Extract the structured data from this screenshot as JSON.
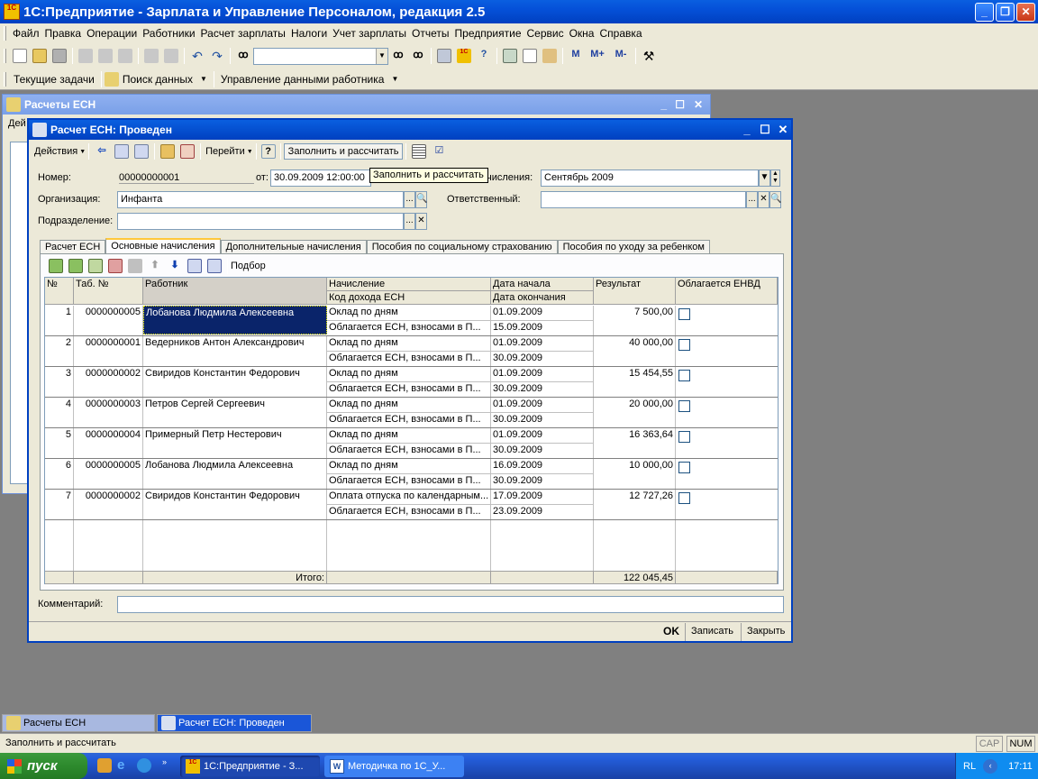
{
  "app": {
    "title": "1С:Предприятие - Зарплата и Управление Персоналом, редакция 2.5",
    "logo": "1C"
  },
  "menu": [
    "Файл",
    "Правка",
    "Операции",
    "Работники",
    "Расчет зарплаты",
    "Налоги",
    "Учет зарплаты",
    "Отчеты",
    "Предприятие",
    "Сервис",
    "Окна",
    "Справка"
  ],
  "toolbar2": {
    "current_tasks": "Текущие задачи",
    "search_data": "Поиск данных",
    "employee_data": "Управление данными работника"
  },
  "backwin": {
    "title": "Расчеты ЕСН",
    "actions": "Дей"
  },
  "doc": {
    "title": "Расчет ЕСН: Проведен",
    "actions_label": "Действия",
    "goto_label": "Перейти",
    "help_label": "?",
    "fill_button": "Заполнить и рассчитать",
    "tooltip": "Заполнить и рассчитать",
    "number_label": "Номер:",
    "number_value": "00000000001",
    "date_label": "от:",
    "date_value": "30.09.2009 12:00:00",
    "month_label": "числения:",
    "month_value": "Сентябрь 2009",
    "org_label": "Организация:",
    "org_value": "Инфанта",
    "resp_label": "Ответственный:",
    "resp_value": "",
    "dept_label": "Подразделение:",
    "dept_value": "",
    "comment_label": "Комментарий:",
    "comment_value": "",
    "ok": "OK",
    "save": "Записать",
    "close": "Закрыть"
  },
  "tabs": [
    "Расчет ЕСН",
    "Основные начисления",
    "Дополнительные начисления",
    "Пособия по социальному страхованию",
    "Пособия по уходу за ребенком"
  ],
  "grid_toolbar": {
    "pick": "Подбор"
  },
  "grid": {
    "headers": {
      "num": "№",
      "tab": "Таб. №",
      "worker": "Работник",
      "accrual": "Начисление",
      "income_code": "Код дохода ЕСН",
      "date_start": "Дата начала",
      "date_end": "Дата окончания",
      "result": "Результат",
      "envd": "Облагается ЕНВД"
    },
    "rows": [
      {
        "n": "1",
        "tab": "0000000005",
        "worker": "Лобанова Людмила Алексеевна",
        "accrual": "Оклад по дням",
        "code": "Облагается ЕСН, взносами в П...",
        "start": "01.09.2009",
        "end": "15.09.2009",
        "result": "7 500,00"
      },
      {
        "n": "2",
        "tab": "0000000001",
        "worker": "Ведерников  Антон Александрович",
        "accrual": "Оклад по дням",
        "code": "Облагается ЕСН, взносами в П...",
        "start": "01.09.2009",
        "end": "30.09.2009",
        "result": "40 000,00"
      },
      {
        "n": "3",
        "tab": "0000000002",
        "worker": "Свиридов Константин Федорович",
        "accrual": "Оклад по дням",
        "code": "Облагается ЕСН, взносами в П...",
        "start": "01.09.2009",
        "end": "30.09.2009",
        "result": "15 454,55"
      },
      {
        "n": "4",
        "tab": "0000000003",
        "worker": "Петров Сергей Сергеевич",
        "accrual": "Оклад по дням",
        "code": "Облагается ЕСН, взносами в П...",
        "start": "01.09.2009",
        "end": "30.09.2009",
        "result": "20 000,00"
      },
      {
        "n": "5",
        "tab": "0000000004",
        "worker": "Примерный Петр Нестерович",
        "accrual": "Оклад по дням",
        "code": "Облагается ЕСН, взносами в П...",
        "start": "01.09.2009",
        "end": "30.09.2009",
        "result": "16 363,64"
      },
      {
        "n": "6",
        "tab": "0000000005",
        "worker": "Лобанова Людмила Алексеевна",
        "accrual": "Оклад по дням",
        "code": "Облагается ЕСН, взносами в П...",
        "start": "16.09.2009",
        "end": "30.09.2009",
        "result": "10 000,00"
      },
      {
        "n": "7",
        "tab": "0000000002",
        "worker": "Свиридов Константин Федорович",
        "accrual": "Оплата отпуска по календарным...",
        "code": "Облагается ЕСН, взносами в П...",
        "start": "17.09.2009",
        "end": "23.09.2009",
        "result": "12 727,26"
      }
    ],
    "total_label": "Итого:",
    "total_value": "122 045,45"
  },
  "mdi_tasks": [
    "Расчеты ЕСН",
    "Расчет ЕСН: Проведен"
  ],
  "status": {
    "text": "Заполнить и рассчитать",
    "cap": "CAP",
    "num": "NUM"
  },
  "taskbar": {
    "start": "пуск",
    "task1": "1С:Предприятие - З...",
    "task2": "Методичка по 1С_У...",
    "lang": "RL",
    "time": "17:11"
  }
}
